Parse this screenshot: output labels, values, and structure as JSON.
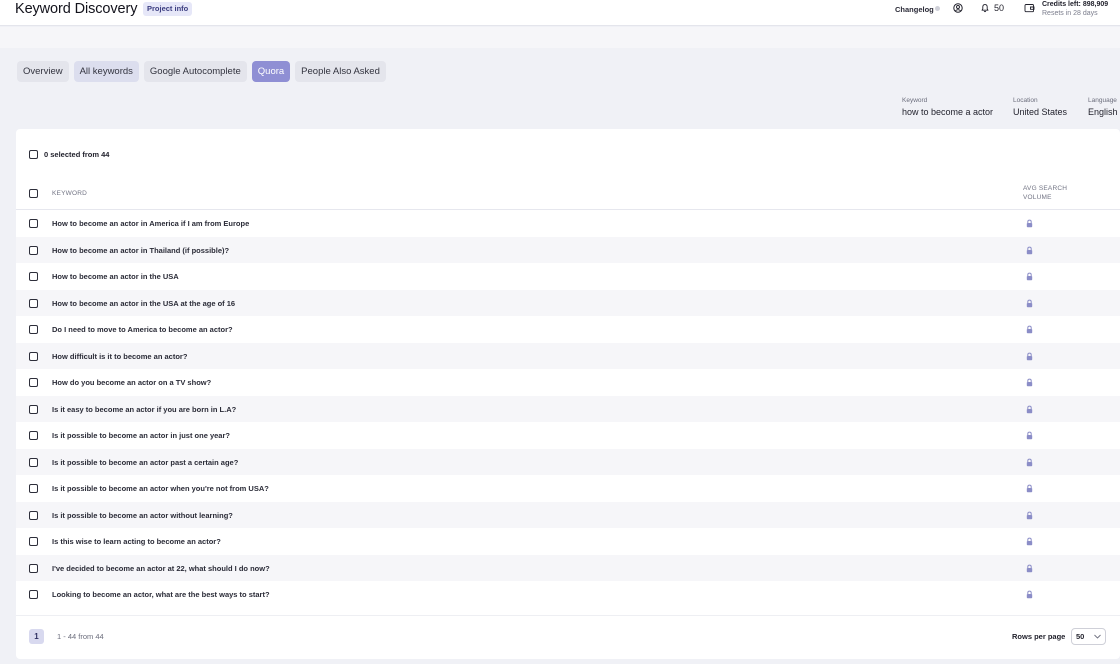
{
  "header": {
    "title": "Keyword Discovery",
    "project_badge": "Project info",
    "changelog": "Changelog",
    "notification_count": "50",
    "credits": "Credits left: 898,909",
    "resets": "Resets in 28 days"
  },
  "tabs": [
    {
      "label": "Overview",
      "state": "default"
    },
    {
      "label": "All keywords",
      "state": "muted"
    },
    {
      "label": "Google Autocomplete",
      "state": "default"
    },
    {
      "label": "Quora",
      "state": "active"
    },
    {
      "label": "People Also Asked",
      "state": "default"
    }
  ],
  "meta": {
    "keyword_label": "Keyword",
    "keyword_value": "how to become a actor",
    "location_label": "Location",
    "location_value": "United States",
    "language_label": "Language",
    "language_value": "English"
  },
  "table": {
    "selected_text": "0 selected from 44",
    "col_keyword": "KEYWORD",
    "col_volume": "AVG SEARCH VOLUME",
    "rows": [
      "How to become an actor in America if I am from Europe",
      "How to become an actor in Thailand (if possible)?",
      "How to become an actor in the USA",
      "How to become an actor in the USA at the age of 16",
      "Do I need to move to America to become an actor?",
      "How difficult is it to become an actor?",
      "How do you become an actor on a TV show?",
      "Is it easy to become an actor if you are born in L.A?",
      "Is it possible to become an actor in just one year?",
      "Is it possible to become an actor past a certain age?",
      "Is it possible to become an actor when you're not from USA?",
      "Is it possible to become an actor without learning?",
      "Is this wise to learn acting to become an actor?",
      "I've decided to become an actor at 22, what should I do now?",
      "Looking to become an actor, what are the best ways to start?"
    ]
  },
  "pagination": {
    "current_page": "1",
    "range": "1 - 44 from 44",
    "rows_per_page_label": "Rows per page",
    "rows_per_page_value": "50"
  },
  "colors": {
    "accent": "#8f8fd4",
    "lock": "#8b8dc7"
  },
  "icons": {
    "account": "account-circle-icon",
    "bell": "bell-icon",
    "wallet": "wallet-icon",
    "lock": "lock-icon",
    "chevron": "chevron-down-icon"
  }
}
